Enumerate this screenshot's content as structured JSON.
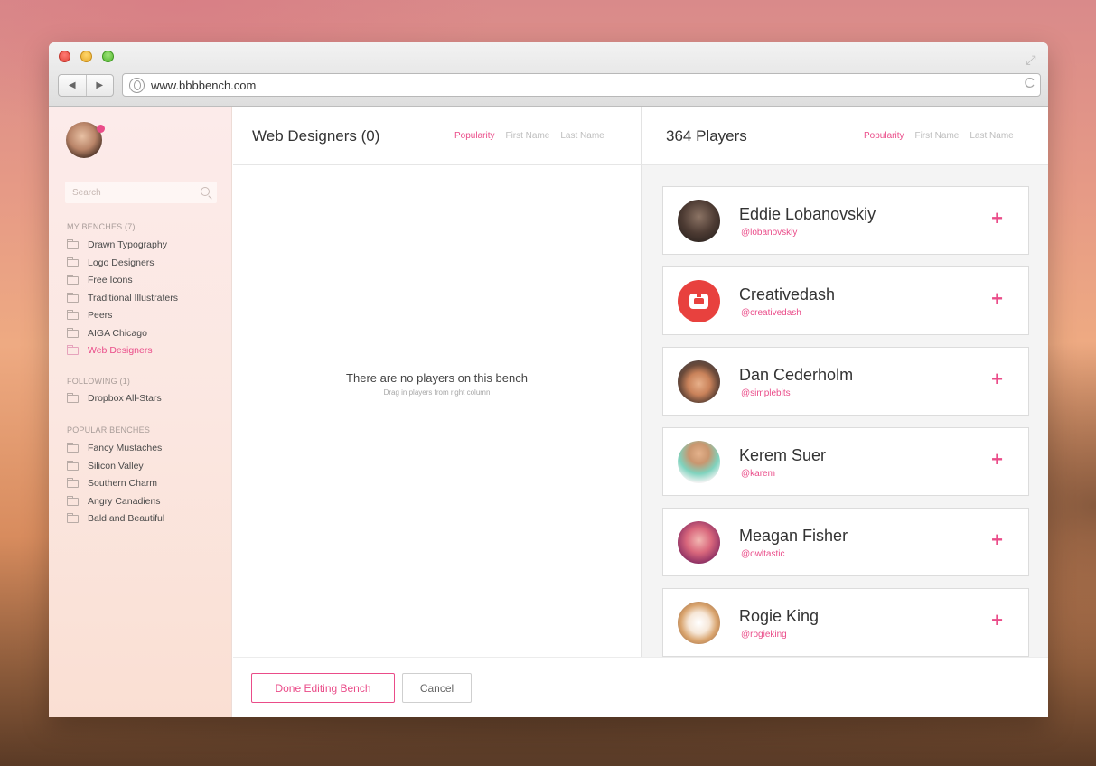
{
  "browser": {
    "url": "www.bbbbench.com",
    "back_icon": "◀",
    "forward_icon": "▶",
    "reload_icon": "C",
    "expand_icon": "⤢"
  },
  "sidebar": {
    "search_placeholder": "Search",
    "sections": [
      {
        "title": "MY BENCHES (7)",
        "items": [
          "Drawn Typography",
          "Logo Designers",
          "Free Icons",
          "Traditional Illustraters",
          "Peers",
          "AIGA Chicago",
          "Web Designers"
        ]
      },
      {
        "title": "FOLLOWING (1)",
        "items": [
          "Dropbox All-Stars"
        ]
      },
      {
        "title": "POPULAR BENCHES",
        "items": [
          "Fancy Mustaches",
          "Silicon Valley",
          "Southern Charm",
          "Angry Canadiens",
          "Bald and Beautiful"
        ]
      }
    ]
  },
  "bench": {
    "title": "Web Designers (0)",
    "sort": [
      "Popularity",
      "First Name",
      "Last Name"
    ],
    "empty_title": "There are no players on this bench",
    "empty_hint": "Drag in players from right column"
  },
  "players": {
    "title": "364 Players",
    "sort": [
      "Popularity",
      "First Name",
      "Last Name"
    ],
    "add_symbol": "+",
    "list": [
      {
        "name": "Eddie Lobanovskiy",
        "handle": "@lobanovskiy"
      },
      {
        "name": "Creativedash",
        "handle": "@creativedash"
      },
      {
        "name": "Dan Cederholm",
        "handle": "@simplebits"
      },
      {
        "name": "Kerem Suer",
        "handle": "@karem"
      },
      {
        "name": "Meagan Fisher",
        "handle": "@owltastic"
      },
      {
        "name": "Rogie King",
        "handle": "@rogieking"
      }
    ]
  },
  "footer": {
    "done_label": "Done Editing Bench",
    "cancel_label": "Cancel"
  },
  "colors": {
    "accent": "#ea4c89"
  }
}
